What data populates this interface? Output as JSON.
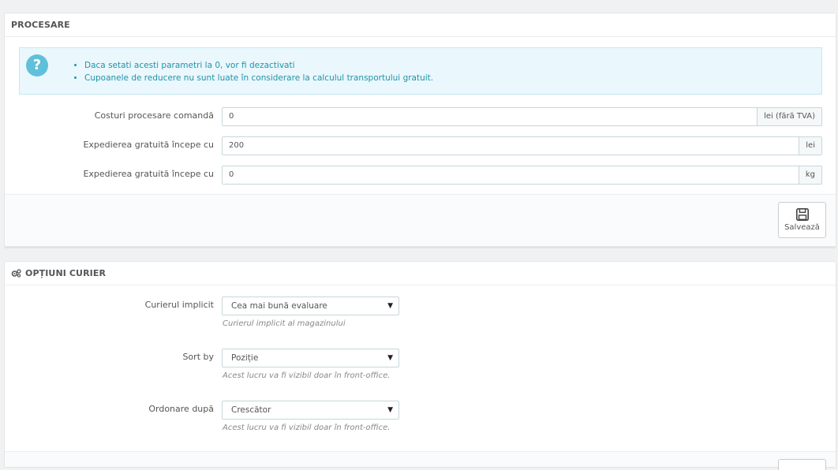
{
  "processing": {
    "heading": "PROCESARE",
    "alert": {
      "icon": "question-icon",
      "items": [
        "Daca setati acesti parametri la 0, vor fi dezactivati",
        "Cupoanele de reducere nu sunt luate în considerare la calculul transportului gratuit."
      ]
    },
    "fields": [
      {
        "label": "Costuri procesare comandă",
        "value": "0",
        "addon": "lei (fără TVA)"
      },
      {
        "label": "Expedierea gratuită începe cu",
        "value": "200",
        "addon": "lei"
      },
      {
        "label": "Expedierea gratuită începe cu",
        "value": "0",
        "addon": "kg"
      }
    ],
    "save_label": "Salvează"
  },
  "carrier": {
    "heading": "OPȚIUNI CURIER",
    "icon": "cogs-icon",
    "fields": [
      {
        "label": "Curierul implicit",
        "value": "Cea mai bună evaluare",
        "help": "Curierul implicit al magazinului"
      },
      {
        "label": "Sort by",
        "value": "Poziție",
        "help": "Acest lucru va fi vizibil doar în front-office."
      },
      {
        "label": "Ordonare după",
        "value": "Crescător",
        "help": "Acest lucru va fi vizibil doar în front-office."
      }
    ]
  }
}
